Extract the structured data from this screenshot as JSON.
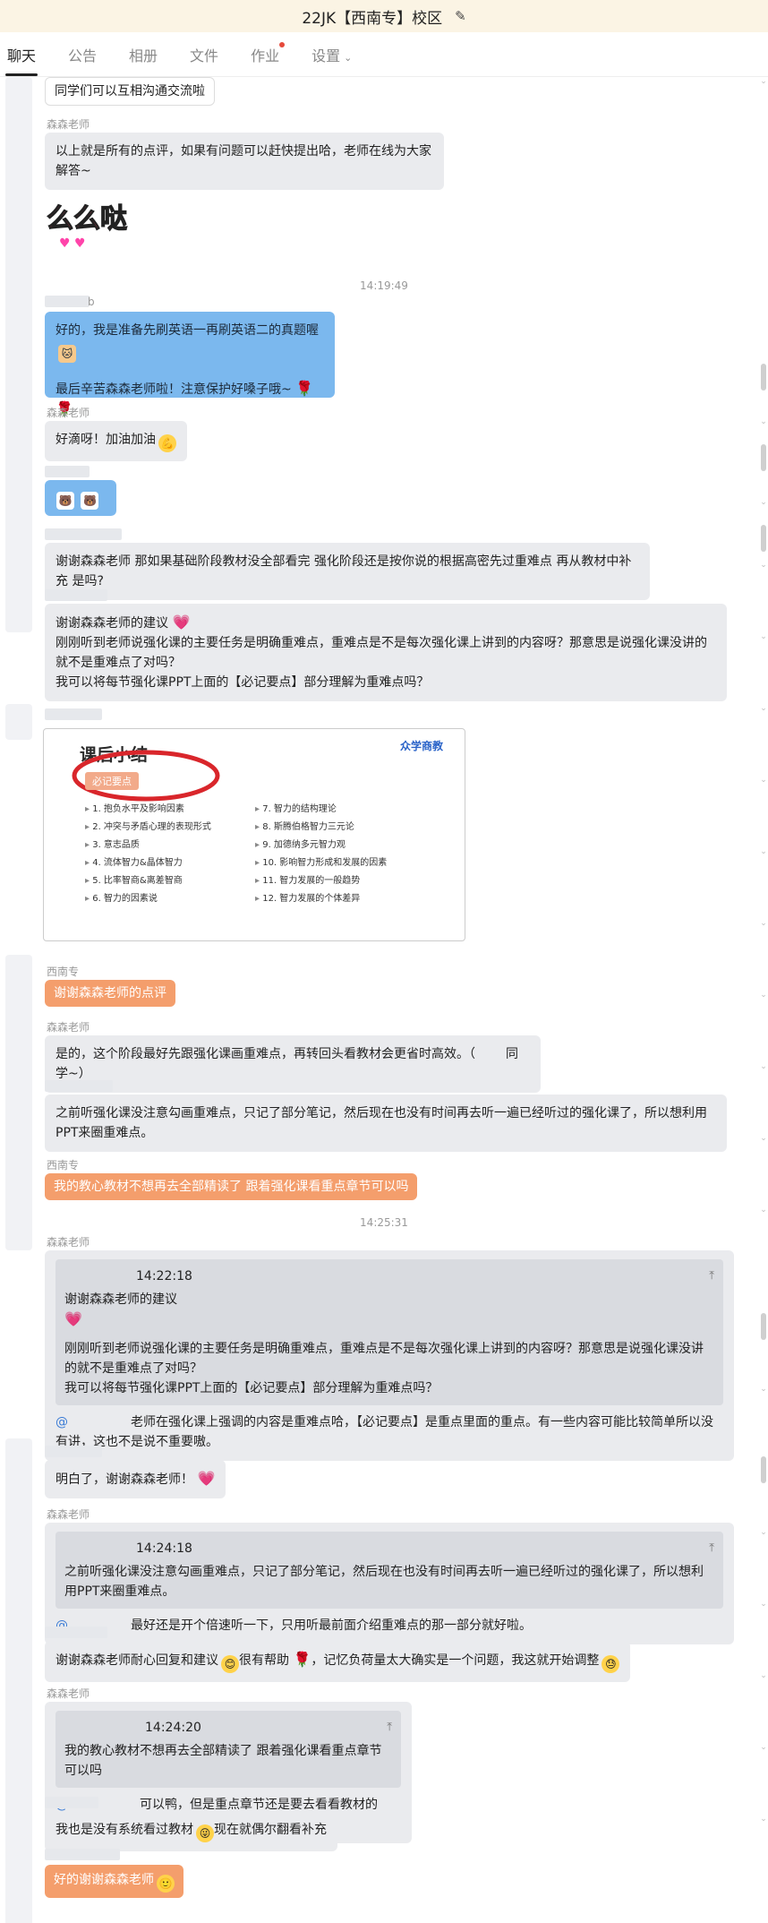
{
  "header": {
    "title": "22JK【西南专】校区",
    "edit_icon": "pencil-icon"
  },
  "tabs": [
    {
      "label": "聊天",
      "active": true
    },
    {
      "label": "公告"
    },
    {
      "label": "相册"
    },
    {
      "label": "文件"
    },
    {
      "label": "作业",
      "badge": true
    },
    {
      "label": "设置",
      "dropdown": true
    }
  ],
  "messages": {
    "m0": {
      "text": "同学们可以互相沟通交流啦"
    },
    "m1": {
      "sender": "森森老师",
      "text": "以上就是所有的点评，如果有问题可以赶快提出哈，老师在线为大家解答~"
    },
    "sticker1": {
      "text": "么么哒"
    },
    "ts1": "14:19:49",
    "m2": {
      "sender_suffix": "b",
      "line1": "好的，我是准备先刷英语一再刷英语二的真题喔",
      "line2": "最后辛苦森森老师啦！注意保护好嗓子哦~"
    },
    "m3": {
      "sender": "森森老师",
      "text": "好滴呀！加油加油"
    },
    "m5": {
      "text": "谢谢森森老师 那如果基础阶段教材没全部看完 强化阶段还是按你说的根据高密先过重难点 再从教材中补充 是吗?"
    },
    "m6": {
      "line1": "谢谢森森老师的建议",
      "line2": "刚刚听到老师说强化课的主要任务是明确重难点，重难点是不是每次强化课上讲到的内容呀？那意思是说强化课没讲的就不是重难点了对吗？",
      "line3": "我可以将每节强化课PPT上面的【必记要点】部分理解为重难点吗？"
    },
    "image": {
      "title": "课后小结",
      "brand": "众学商教",
      "tag": "必记要点",
      "col1": [
        "1. 抱负水平及影响因素",
        "2. 冲突与矛盾心理的表现形式",
        "3. 意志品质",
        "4. 流体智力&晶体智力",
        "5. 比率智商&离差智商",
        "6. 智力的因素说"
      ],
      "col2": [
        "7. 智力的结构理论",
        "8. 斯腾伯格智力三元论",
        "9. 加德纳多元智力观",
        "10. 影响智力形成和发展的因素",
        "11. 智力发展的一般趋势",
        "12. 智力发展的个体差异"
      ]
    },
    "m7": {
      "sender": "西南专",
      "text": "谢谢森森老师的点评"
    },
    "m8": {
      "sender": "森森老师",
      "text": "是的，这个阶段最好先跟强化课画重难点，再转回头看教材会更省时高效。（",
      "tail": "同学~）"
    },
    "m9": {
      "text": "之前听强化课没注意勾画重难点，只记了部分笔记，然后现在也没有时间再去听一遍已经听过的强化课了，所以想利用PPT来圈重难点。"
    },
    "m10": {
      "sender": "西南专",
      "text": "我的教心教材不想再去全部精读了 跟着强化课看重点章节可以吗"
    },
    "ts2": "14:25:31",
    "m11": {
      "sender": "森森老师",
      "qtime": "14:22:18",
      "q1": "谢谢森森老师的建议",
      "q2": "刚刚听到老师说强化课的主要任务是明确重难点，重难点是不是每次强化课上讲到的内容呀？那意思是说强化课没讲的就不是重难点了对吗？",
      "q3": "我可以将每节强化课PPT上面的【必记要点】部分理解为重难点吗？",
      "reply": "老师在强化课上强调的内容是重难点哈，【必记要点】是重点里面的重点。有一些内容可能比较简单所以没有讲，这也不是说不重要嗷。"
    },
    "m12": {
      "text": "明白了，谢谢森森老师！"
    },
    "m13": {
      "sender": "森森老师",
      "qtime": "14:24:18",
      "q1": "之前听强化课没注意勾画重难点，只记了部分笔记，然后现在也没有时间再去听一遍已经听过的强化课了，所以想利用PPT来圈重难点。",
      "reply": "最好还是开个倍速听一下，只用听最前面介绍重难点的那一部分就好啦。"
    },
    "m14": {
      "t1": "谢谢森森老师耐心回复和建议",
      "t2": "很有帮助",
      "t3": "，记忆负荷量太大确实是一个问题，我这就开始调整"
    },
    "m15": {
      "sender": "森森老师",
      "qtime": "14:24:20",
      "q1": "我的教心教材不想再去全部精读了 跟着强化课看重点章节可以吗",
      "reply": "可以鸭，但是重点章节还是要去看看教材的哈。"
    },
    "m16": {
      "t1": "我也是没有系统看过教材",
      "t2": "现在就偶尔翻看补充"
    },
    "m17": {
      "text": "好的谢谢森森老师"
    }
  },
  "colors": {
    "teacher_bubble": "#eaebee",
    "blue_bubble": "#7bb8ee",
    "orange_bubble": "#f49e6c",
    "header_bg": "#fbf4e4"
  }
}
